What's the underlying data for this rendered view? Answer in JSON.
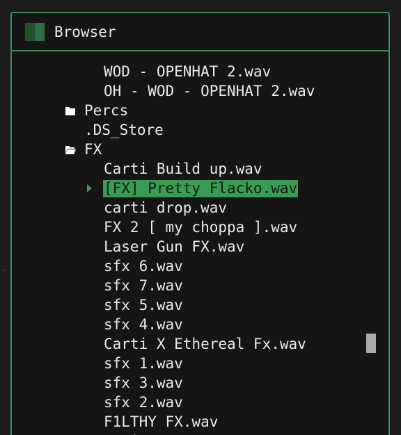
{
  "panel": {
    "title": "Browser",
    "icon": "browser-panel-icon"
  },
  "tree": {
    "items": [
      {
        "label": "WOD - OPENHAT 2.wav",
        "type": "file",
        "depth": 2
      },
      {
        "label": "OH - WOD - OPENHAT 2.wav",
        "type": "file",
        "depth": 2
      },
      {
        "label": "Percs",
        "type": "folder",
        "icon": "folder-closed-icon",
        "depth": 1
      },
      {
        "label": ".DS_Store",
        "type": "file",
        "depth": 1
      },
      {
        "label": "FX",
        "type": "folder",
        "icon": "folder-open-icon",
        "depth": 1
      },
      {
        "label": "Carti Build up.wav",
        "type": "file",
        "depth": 2
      },
      {
        "label": "[FX] Pretty Flacko.wav",
        "type": "file",
        "depth": 2,
        "selected": true,
        "icon": "play-arrow-icon"
      },
      {
        "label": "carti drop.wav",
        "type": "file",
        "depth": 2
      },
      {
        "label": "FX 2 [ my choppa ].wav",
        "type": "file",
        "depth": 2
      },
      {
        "label": "Laser Gun FX.wav",
        "type": "file",
        "depth": 2
      },
      {
        "label": "sfx 6.wav",
        "type": "file",
        "depth": 2
      },
      {
        "label": "sfx 7.wav",
        "type": "file",
        "depth": 2
      },
      {
        "label": "sfx 5.wav",
        "type": "file",
        "depth": 2
      },
      {
        "label": "sfx 4.wav",
        "type": "file",
        "depth": 2
      },
      {
        "label": "Carti X Ethereal Fx.wav",
        "type": "file",
        "depth": 2
      },
      {
        "label": "sfx 1.wav",
        "type": "file",
        "depth": 2
      },
      {
        "label": "sfx 3.wav",
        "type": "file",
        "depth": 2
      },
      {
        "label": "sfx 2.wav",
        "type": "file",
        "depth": 2
      },
      {
        "label": "F1LTHY FX.wav",
        "type": "file",
        "depth": 2
      },
      {
        "label": "Fruit",
        "type": "file",
        "depth": 2
      }
    ]
  },
  "colors": {
    "accent": "#3f8a55",
    "selection": "#3a9b55",
    "background": "#141514",
    "text": "#e8ebe9"
  }
}
